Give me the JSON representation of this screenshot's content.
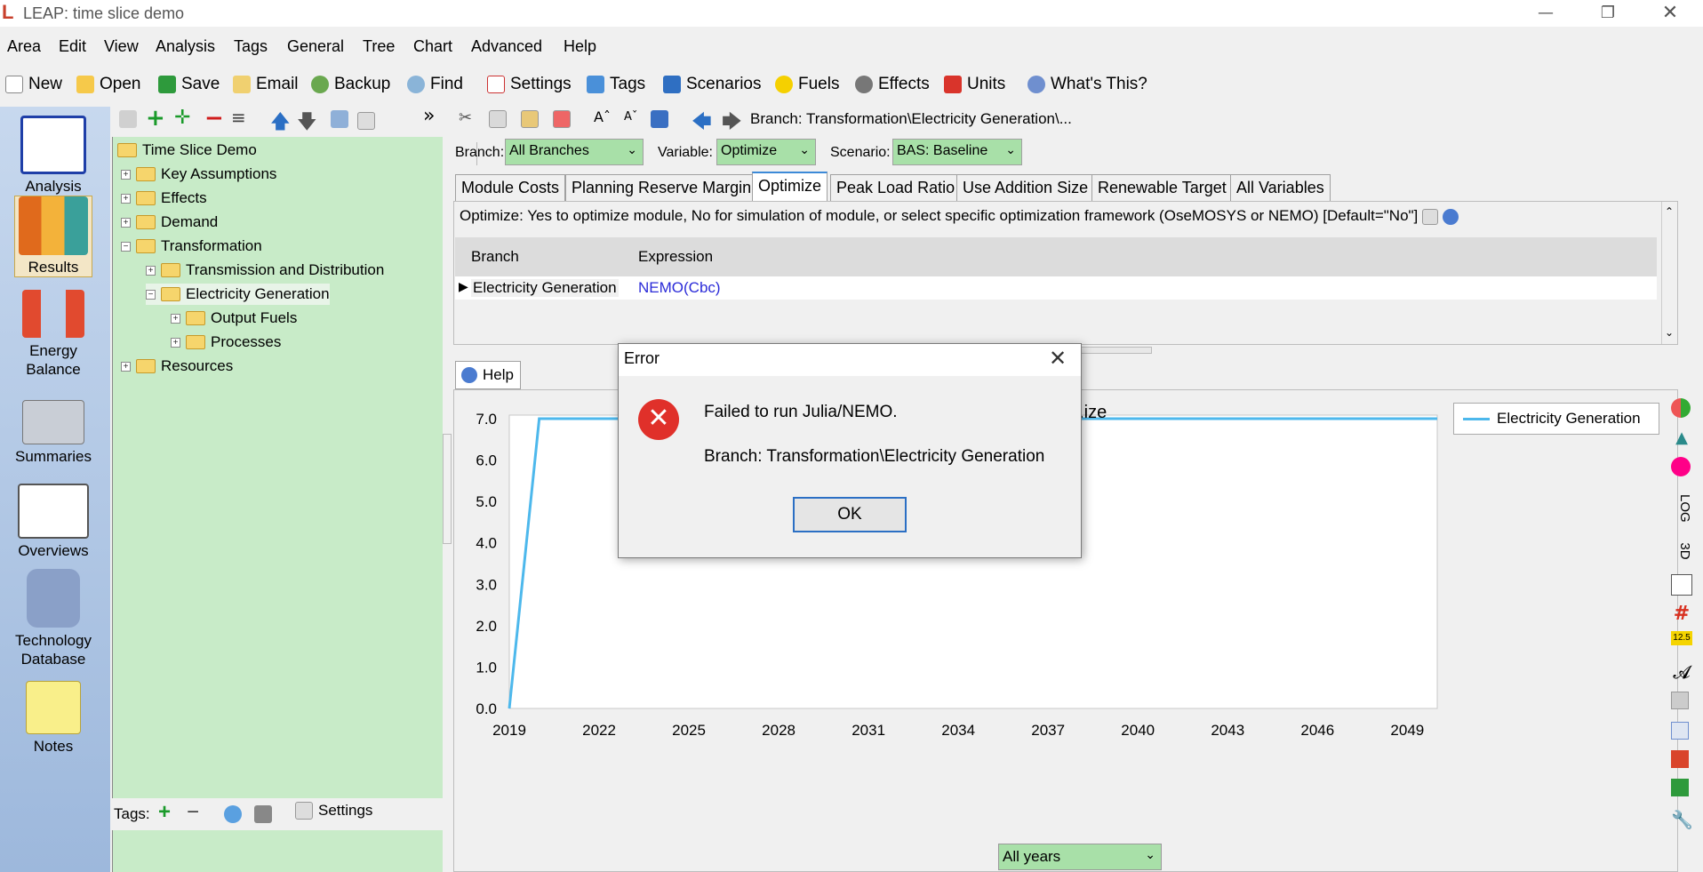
{
  "window": {
    "title": "LEAP: time slice demo"
  },
  "menu": [
    "Area",
    "Edit",
    "View",
    "Analysis",
    "Tags",
    "General",
    "Tree",
    "Chart",
    "Advanced",
    "Help"
  ],
  "toolbar": {
    "new": "New",
    "open": "Open",
    "save": "Save",
    "email": "Email",
    "backup": "Backup",
    "find": "Find",
    "settings": "Settings",
    "tags": "Tags",
    "scenarios": "Scenarios",
    "fuels": "Fuels",
    "effects": "Effects",
    "units": "Units",
    "whats_this": "What's This?"
  },
  "leftbar": [
    "Analysis",
    "Results",
    "Energy Balance",
    "Summaries",
    "Overviews",
    "Technology Database",
    "Notes"
  ],
  "tree": {
    "root": "Time Slice Demo",
    "nodes": [
      "Key Assumptions",
      "Effects",
      "Demand",
      "Transformation",
      "Transmission and Distribution",
      "Electricity Generation",
      "Output Fuels",
      "Processes",
      "Resources"
    ]
  },
  "tagsbar": {
    "label": "Tags:",
    "settings": "Settings"
  },
  "breadcrumb": "Branch: Transformation\\Electricity Generation\\...",
  "filters": {
    "branch_label": "Branch:",
    "branch_value": "All Branches",
    "variable_label": "Variable:",
    "variable_value": "Optimize",
    "scenario_label": "Scenario:",
    "scenario_value": "BAS: Baseline"
  },
  "tabs": [
    "Module Costs",
    "Planning Reserve Margin",
    "Optimize",
    "Peak Load Ratio",
    "Use Addition Size",
    "Renewable Target",
    "All Variables"
  ],
  "description": "Optimize: Yes to optimize module, No for simulation of module, or select specific optimization framework (OseMOSYS or NEMO) [Default=\"No\"]",
  "table": {
    "headers": [
      "Branch",
      "Expression"
    ],
    "row": {
      "branch": "Electricity Generation",
      "expression": "NEMO(Cbc)"
    }
  },
  "help_tab": "Help",
  "chart_data": {
    "type": "line",
    "title": "...ize",
    "x": [
      2019,
      2020,
      2022,
      2025,
      2028,
      2031,
      2034,
      2037,
      2040,
      2043,
      2046,
      2049,
      2050
    ],
    "series": [
      {
        "name": "Electricity Generation",
        "values": [
          0,
          7,
          7,
          7,
          7,
          7,
          7,
          7,
          7,
          7,
          7,
          7,
          7
        ]
      }
    ],
    "x_ticks": [
      "2019",
      "2022",
      "2025",
      "2028",
      "2031",
      "2034",
      "2037",
      "2040",
      "2043",
      "2046",
      "2049"
    ],
    "y_ticks": [
      "0.0",
      "1.0",
      "2.0",
      "3.0",
      "4.0",
      "5.0",
      "6.0",
      "7.0"
    ],
    "xlim": [
      2019,
      2050
    ],
    "ylim": [
      0,
      7
    ],
    "legend": "top-right",
    "color": "#4db8ec"
  },
  "years_select": "All years",
  "side_icons": {
    "log": "LOG",
    "three_d": "3D",
    "num": "12.5"
  },
  "dialog": {
    "title": "Error",
    "message": "Failed to run Julia/NEMO.",
    "detail": "Branch: Transformation\\Electricity Generation",
    "ok": "OK"
  }
}
